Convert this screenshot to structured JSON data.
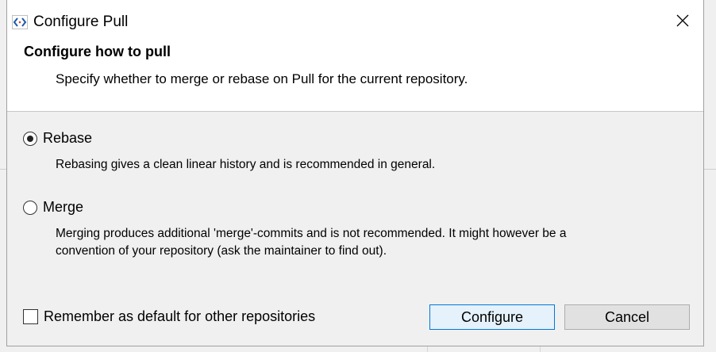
{
  "window": {
    "title": "Configure Pull",
    "close_icon": "close-icon",
    "app_icon": "code-brackets-icon"
  },
  "header": {
    "title": "Configure how to pull",
    "description": "Specify whether to merge or rebase on Pull for the current repository."
  },
  "options": [
    {
      "label": "Rebase",
      "description": "Rebasing gives a clean linear history and is recommended in general.",
      "selected": true
    },
    {
      "label": "Merge",
      "description_line1": "Merging produces additional 'merge'-commits and is not recommended. It might however be a",
      "description_line2": "convention of your repository (ask the maintainer to find out).",
      "selected": false
    }
  ],
  "remember": {
    "label": "Remember as default for other repositories",
    "checked": false
  },
  "buttons": {
    "configure": "Configure",
    "cancel": "Cancel"
  },
  "colors": {
    "primary_button_border": "#0078d7",
    "primary_button_bg": "#e5f1fb",
    "icon_accent": "#1e5aa8"
  }
}
